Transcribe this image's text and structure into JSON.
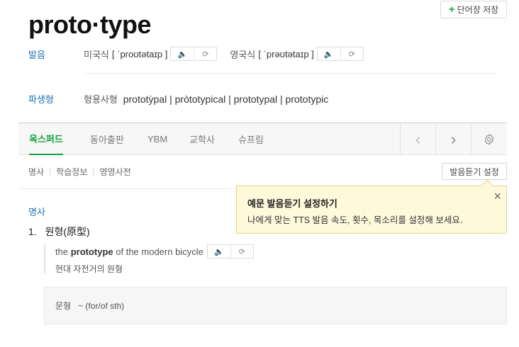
{
  "save_button": {
    "label": "단어장 저장",
    "plus": "+"
  },
  "headword": "proto·type",
  "pronunciation": {
    "label": "발음",
    "us_kind": "미국식",
    "us_ipa": "[ ˈproʊtətaɪp ]",
    "uk_kind": "영국식",
    "uk_ipa": "[ ˈprəʊtətaɪp ]",
    "speaker_icon": "speaker-icon",
    "repeat_icon": "repeat-icon"
  },
  "derivatives": {
    "label": "파생형",
    "sub_label": "형용사형",
    "text": "prototỳpal | pròtotypical | prototypal | prototypic"
  },
  "tabs": [
    {
      "label": "옥스퍼드",
      "active": true
    },
    {
      "label": "동아출판",
      "active": false
    },
    {
      "label": "YBM",
      "active": false
    },
    {
      "label": "교학사",
      "active": false
    },
    {
      "label": "슈프림",
      "active": false
    }
  ],
  "nav": {
    "prev": "‹",
    "next": "›",
    "settings_icon": "gear-icon"
  },
  "subnav": [
    "명사",
    "학습정보",
    "영영사전"
  ],
  "listen_settings_button": "발음듣기 설정",
  "tooltip": {
    "title": "예문 발음듣기 설정하기",
    "description": "나에게 맞는 TTS 발음 속도, 횟수, 목소리를 설정해 보세요.",
    "close": "×"
  },
  "entry": {
    "pos": "명사",
    "sense_num": "1.",
    "sense_text": "원형(原型)",
    "example_pre": "the ",
    "example_bold": "prototype",
    "example_post": " of the modern bicycle",
    "example_ko": "현대 자전거의 원형",
    "pattern_label": "문형",
    "pattern_text": "~ (for/of sth)"
  },
  "colors": {
    "accent_green": "#13a03a",
    "link_blue": "#1e72b8",
    "tooltip_bg": "#fff9dc"
  }
}
